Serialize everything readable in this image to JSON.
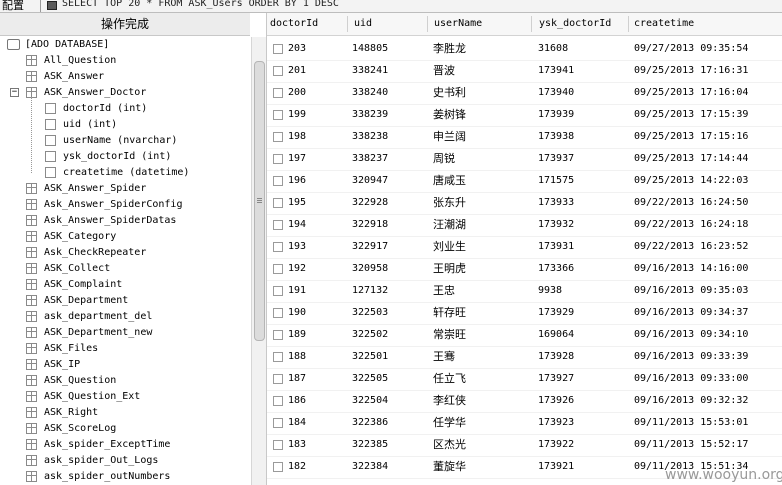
{
  "toolbar": {
    "label": "配置",
    "query": "SELECT TOP 20 * FROM ASK_Users ORDER BY 1 DESC"
  },
  "left_panel": {
    "status": "操作完成",
    "database": "[ADO DATABASE]",
    "tables_before": [
      "All_Question",
      "ASK_Answer"
    ],
    "expanded_table": "ASK_Answer_Doctor",
    "columns": [
      "doctorId (int)",
      "uid (int)",
      "userName (nvarchar)",
      "ysk_doctorId (int)",
      "createtime (datetime)"
    ],
    "tables_after": [
      "ASK_Answer_Spider",
      "Ask_Answer_SpiderConfig",
      "Ask_Answer_SpiderDatas",
      "ASK_Category",
      "Ask_CheckRepeater",
      "ASK_Collect",
      "ASK_Complaint",
      "ASK_Department",
      "ask_department_del",
      "ASK_Department_new",
      "ASK_Files",
      "ASK_IP",
      "ASK_Question",
      "ASK_Question_Ext",
      "ASK_Right",
      "ASK_ScoreLog",
      "Ask_spider_ExceptTime",
      "ask_spider_Out_Logs",
      "ask_spider_outNumbers"
    ]
  },
  "grid": {
    "headers": [
      "doctorId",
      "uid",
      "userName",
      "ysk_doctorId",
      "createtime"
    ],
    "rows": [
      [
        "203",
        "148805",
        "李胜龙",
        "31608",
        "09/27/2013 09:35:54"
      ],
      [
        "201",
        "338241",
        "晋波",
        "173941",
        "09/25/2013 17:16:31"
      ],
      [
        "200",
        "338240",
        "史书利",
        "173940",
        "09/25/2013 17:16:04"
      ],
      [
        "199",
        "338239",
        "姜树锋",
        "173939",
        "09/25/2013 17:15:39"
      ],
      [
        "198",
        "338238",
        "申兰阔",
        "173938",
        "09/25/2013 17:15:16"
      ],
      [
        "197",
        "338237",
        "周锐",
        "173937",
        "09/25/2013 17:14:44"
      ],
      [
        "196",
        "320947",
        "唐咸玉",
        "171575",
        "09/25/2013 14:22:03"
      ],
      [
        "195",
        "322928",
        "张东升",
        "173933",
        "09/22/2013 16:24:50"
      ],
      [
        "194",
        "322918",
        "汪潮湖",
        "173932",
        "09/22/2013 16:24:18"
      ],
      [
        "193",
        "322917",
        "刘业生",
        "173931",
        "09/22/2013 16:23:52"
      ],
      [
        "192",
        "320958",
        "王明虎",
        "173366",
        "09/16/2013 14:16:00"
      ],
      [
        "191",
        "127132",
        "王忠",
        "9938",
        "09/16/2013 09:35:03"
      ],
      [
        "190",
        "322503",
        "轩存旺",
        "173929",
        "09/16/2013 09:34:37"
      ],
      [
        "189",
        "322502",
        "常崇旺",
        "169064",
        "09/16/2013 09:34:10"
      ],
      [
        "188",
        "322501",
        "王骞",
        "173928",
        "09/16/2013 09:33:39"
      ],
      [
        "187",
        "322505",
        "任立飞",
        "173927",
        "09/16/2013 09:33:00"
      ],
      [
        "186",
        "322504",
        "李红侠",
        "173926",
        "09/16/2013 09:32:32"
      ],
      [
        "184",
        "322386",
        "任学华",
        "173923",
        "09/11/2013 15:53:01"
      ],
      [
        "183",
        "322385",
        "区杰光",
        "173922",
        "09/11/2013 15:52:17"
      ],
      [
        "182",
        "322384",
        "董旋华",
        "173921",
        "09/11/2013 15:51:34"
      ]
    ]
  },
  "watermark": "www.wooyun.org"
}
